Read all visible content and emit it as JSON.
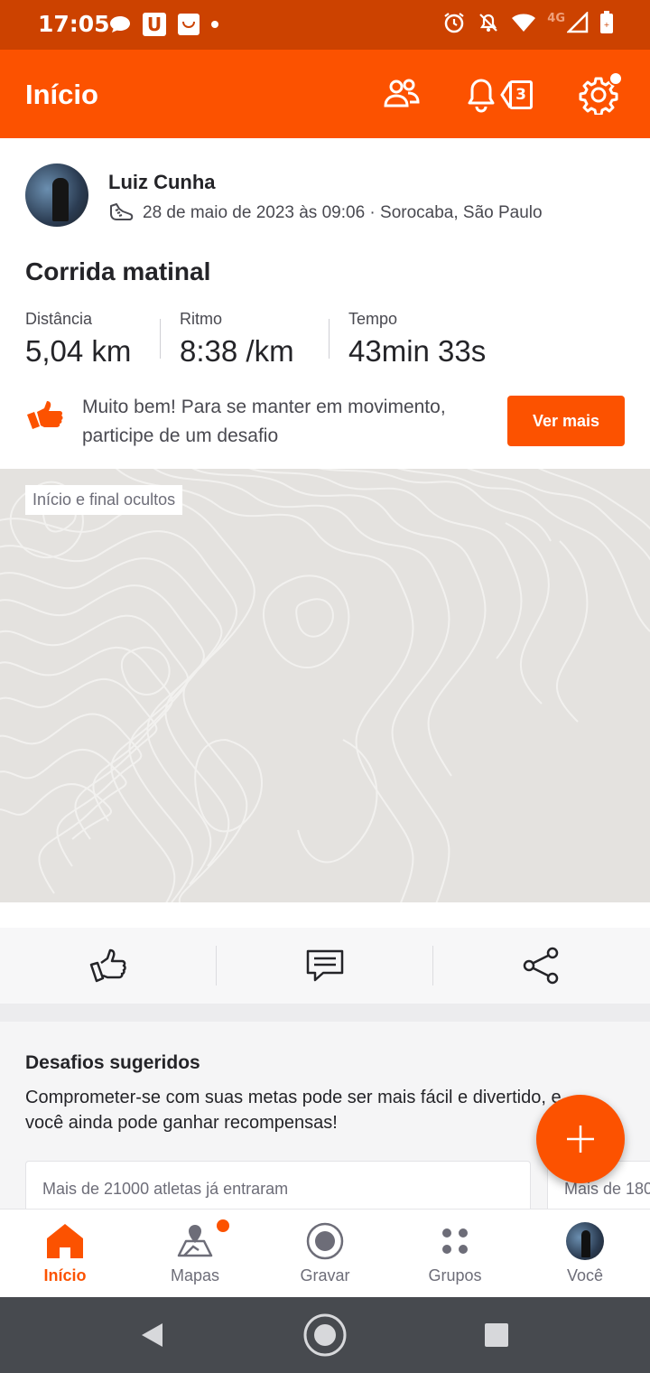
{
  "status_bar": {
    "time": "17:05",
    "left_icons": [
      "chat-bubble-icon",
      "u-app-icon",
      "shopping-bag-icon",
      "dot-icon"
    ],
    "right_icons": [
      "alarm-icon",
      "bell-off-icon",
      "wifi-icon",
      "cell-signal-icon",
      "battery-icon"
    ],
    "network": "4G"
  },
  "header": {
    "title": "Início",
    "notification_count": "3",
    "icons": [
      "athletes-icon",
      "bell-icon",
      "notification-count-icon",
      "gear-icon"
    ],
    "accent_color": "#fc5200"
  },
  "activity": {
    "athlete_name": "Luiz Cunha",
    "date_location": "28 de maio de 2023 às 09:06 · Sorocaba, São Paulo",
    "title": "Corrida matinal",
    "stats": [
      {
        "label": "Distância",
        "value": "5,04 km"
      },
      {
        "label": "Ritmo",
        "value": "8:38 /km"
      },
      {
        "label": "Tempo",
        "value": "43min 33s"
      }
    ],
    "promo_text": "Muito bem! Para se manter em movimento, participe de um desafio",
    "promo_button": "Ver mais",
    "map_chip": "Início e final ocultos"
  },
  "actions": [
    "thumbs-up-icon",
    "comment-icon",
    "share-icon"
  ],
  "challenges": {
    "title": "Desafios sugeridos",
    "description": "Comprometer-se com suas metas pode ser mais fácil e divertido, e você ainda pode ganhar recompensas!",
    "cards": [
      {
        "text": "Mais de 21000 atletas já entraram"
      },
      {
        "text": "Mais de 180"
      }
    ]
  },
  "fab": {
    "icon": "plus-icon"
  },
  "bottom_nav": [
    {
      "label": "Início",
      "icon": "home-icon",
      "active": true
    },
    {
      "label": "Mapas",
      "icon": "map-icon",
      "badge": true
    },
    {
      "label": "Gravar",
      "icon": "record-icon"
    },
    {
      "label": "Grupos",
      "icon": "groups-icon"
    },
    {
      "label": "Você",
      "icon": "avatar"
    }
  ],
  "system_nav": [
    "back-icon",
    "home-circle-icon",
    "recents-icon"
  ]
}
